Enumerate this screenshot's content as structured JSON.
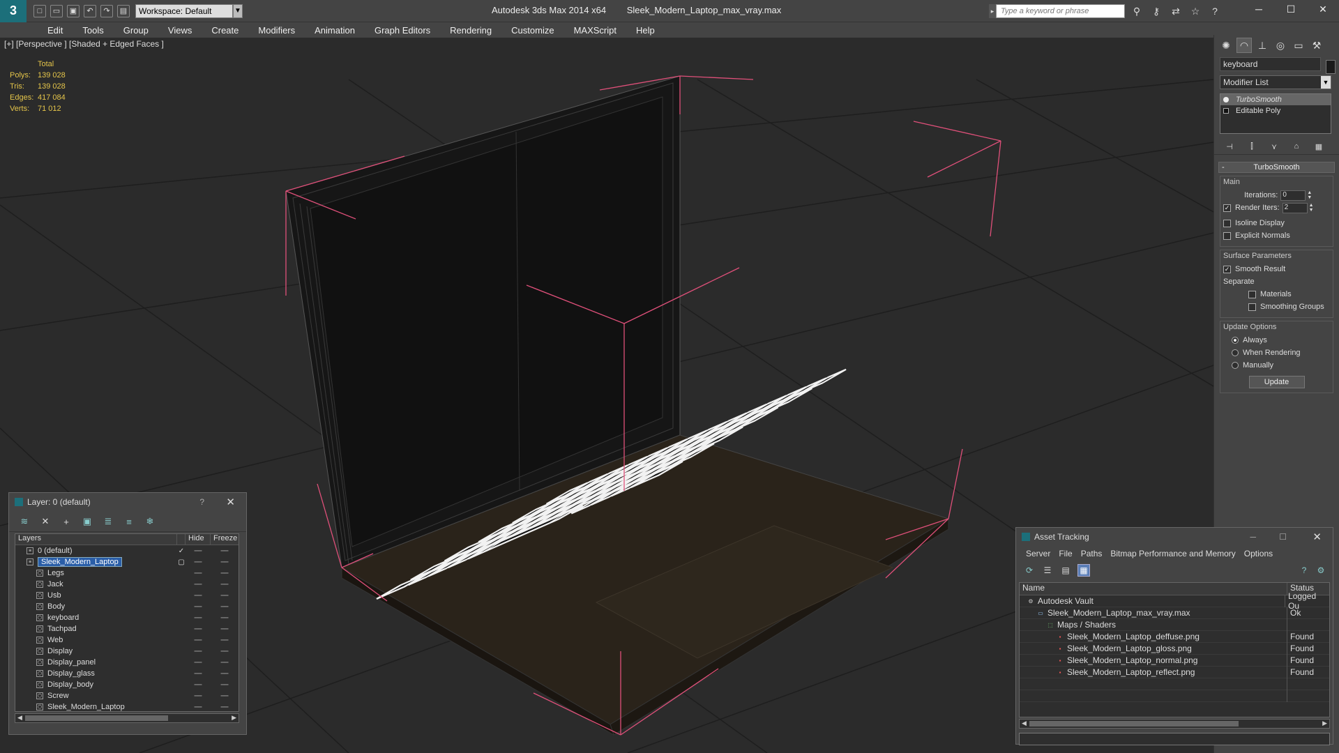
{
  "titlebar": {
    "app_title": "Autodesk 3ds Max 2014 x64",
    "file_name": "Sleek_Modern_Laptop_max_vray.max",
    "workspace": "Workspace: Default",
    "search_placeholder": "Type a keyword or phrase"
  },
  "menu": [
    "Edit",
    "Tools",
    "Group",
    "Views",
    "Create",
    "Modifiers",
    "Animation",
    "Graph Editors",
    "Rendering",
    "Customize",
    "MAXScript",
    "Help"
  ],
  "viewport": {
    "label": "[+] [Perspective ] [Shaded + Edged Faces ]",
    "stats": {
      "header": "Total",
      "rows": [
        {
          "k": "Polys:",
          "v": "139 028"
        },
        {
          "k": "Tris:",
          "v": "139 028"
        },
        {
          "k": "Edges:",
          "v": "417 084"
        },
        {
          "k": "Verts:",
          "v": "71 012"
        }
      ]
    }
  },
  "command_panel": {
    "object_name": "keyboard",
    "modifier_list": "Modifier List",
    "stack": [
      "TurboSmooth",
      "Editable Poly"
    ],
    "rollout": "TurboSmooth",
    "main_group": "Main",
    "iterations_label": "Iterations:",
    "iterations_value": "0",
    "render_iters_label": "Render Iters:",
    "render_iters_value": "2",
    "isoline": "Isoline Display",
    "explicit": "Explicit Normals",
    "surface_group": "Surface Parameters",
    "smooth_result": "Smooth Result",
    "separate": "Separate",
    "materials": "Materials",
    "smoothing_groups": "Smoothing Groups",
    "update_group": "Update Options",
    "always": "Always",
    "when_rendering": "When Rendering",
    "manually": "Manually",
    "update_btn": "Update"
  },
  "layer_dialog": {
    "title": "Layer: 0 (default)",
    "help": "?",
    "col_layers": "Layers",
    "col_hide": "Hide",
    "col_freeze": "Freeze",
    "rows": [
      {
        "name": "0 (default)",
        "level": 0
      },
      {
        "name": "Sleek_Modern_Laptop",
        "level": 0
      },
      {
        "name": "Legs",
        "level": 1
      },
      {
        "name": "Jack",
        "level": 1
      },
      {
        "name": "Usb",
        "level": 1
      },
      {
        "name": "Body",
        "level": 1
      },
      {
        "name": "keyboard",
        "level": 1
      },
      {
        "name": "Tachpad",
        "level": 1
      },
      {
        "name": "Web",
        "level": 1
      },
      {
        "name": "Display",
        "level": 1
      },
      {
        "name": "Display_panel",
        "level": 1
      },
      {
        "name": "Display_glass",
        "level": 1
      },
      {
        "name": "Display_body",
        "level": 1
      },
      {
        "name": "Screw",
        "level": 1
      },
      {
        "name": "Sleek_Modern_Laptop",
        "level": 1
      }
    ]
  },
  "asset_dialog": {
    "title": "Asset Tracking",
    "menu": [
      "Server",
      "File",
      "Paths",
      "Bitmap Performance and Memory",
      "Options"
    ],
    "col_name": "Name",
    "col_status": "Status",
    "rows": [
      {
        "name": "Autodesk Vault",
        "status": "Logged Ou",
        "level": 0,
        "icon": "vault"
      },
      {
        "name": "Sleek_Modern_Laptop_max_vray.max",
        "status": "Ok",
        "level": 1,
        "icon": "max"
      },
      {
        "name": "Maps / Shaders",
        "status": "",
        "level": 2,
        "icon": "maps"
      },
      {
        "name": "Sleek_Modern_Laptop_deffuse.png",
        "status": "Found",
        "level": 3,
        "icon": "png"
      },
      {
        "name": "Sleek_Modern_Laptop_gloss.png",
        "status": "Found",
        "level": 3,
        "icon": "png"
      },
      {
        "name": "Sleek_Modern_Laptop_normal.png",
        "status": "Found",
        "level": 3,
        "icon": "png"
      },
      {
        "name": "Sleek_Modern_Laptop_reflect.png",
        "status": "Found",
        "level": 3,
        "icon": "png"
      }
    ]
  },
  "colors": {
    "bounding_box": "#e0507a",
    "selection": "#2a5ea8",
    "stats_text": "#e5c54a"
  }
}
